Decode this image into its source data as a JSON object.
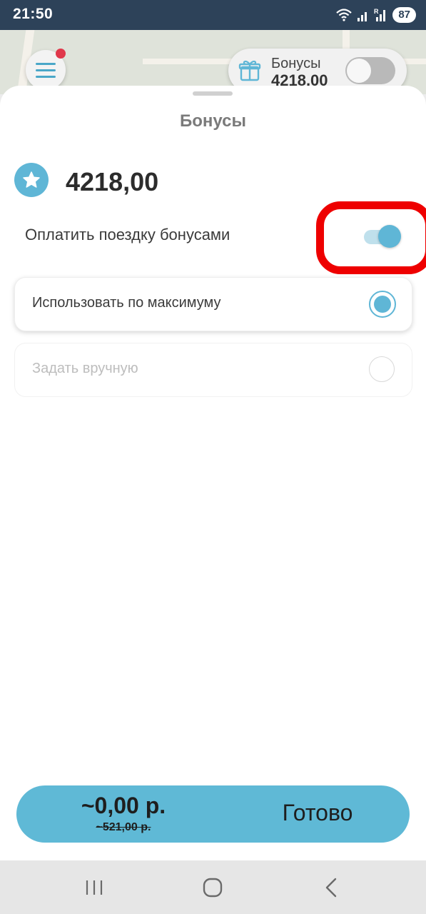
{
  "status_bar": {
    "time": "21:50",
    "battery": "87",
    "icons": [
      "wifi-icon",
      "signal-icon",
      "roaming-signal-icon"
    ]
  },
  "background": {
    "bonus_widget": {
      "label": "Бонусы",
      "value": "4218,00",
      "toggle_on": false,
      "icon": "gift-icon"
    }
  },
  "sheet": {
    "title": "Бонусы",
    "balance": "4218,00",
    "balance_icon": "star-icon",
    "pay_with_bonuses_label": "Оплатить поездку бонусами",
    "pay_with_bonuses_on": true,
    "options": [
      {
        "label": "Использовать по максимуму",
        "selected": true
      },
      {
        "label": "Задать вручную",
        "selected": false
      }
    ],
    "cta": {
      "price": "~0,00 р.",
      "old_price": "~521,00 р.",
      "label": "Готово"
    }
  },
  "colors": {
    "accent": "#5fb6d6",
    "highlight": "#ee0000",
    "status_bar": "#2d4259"
  },
  "nav_bar": {
    "buttons": [
      "recents-icon",
      "home-icon",
      "back-icon"
    ]
  }
}
